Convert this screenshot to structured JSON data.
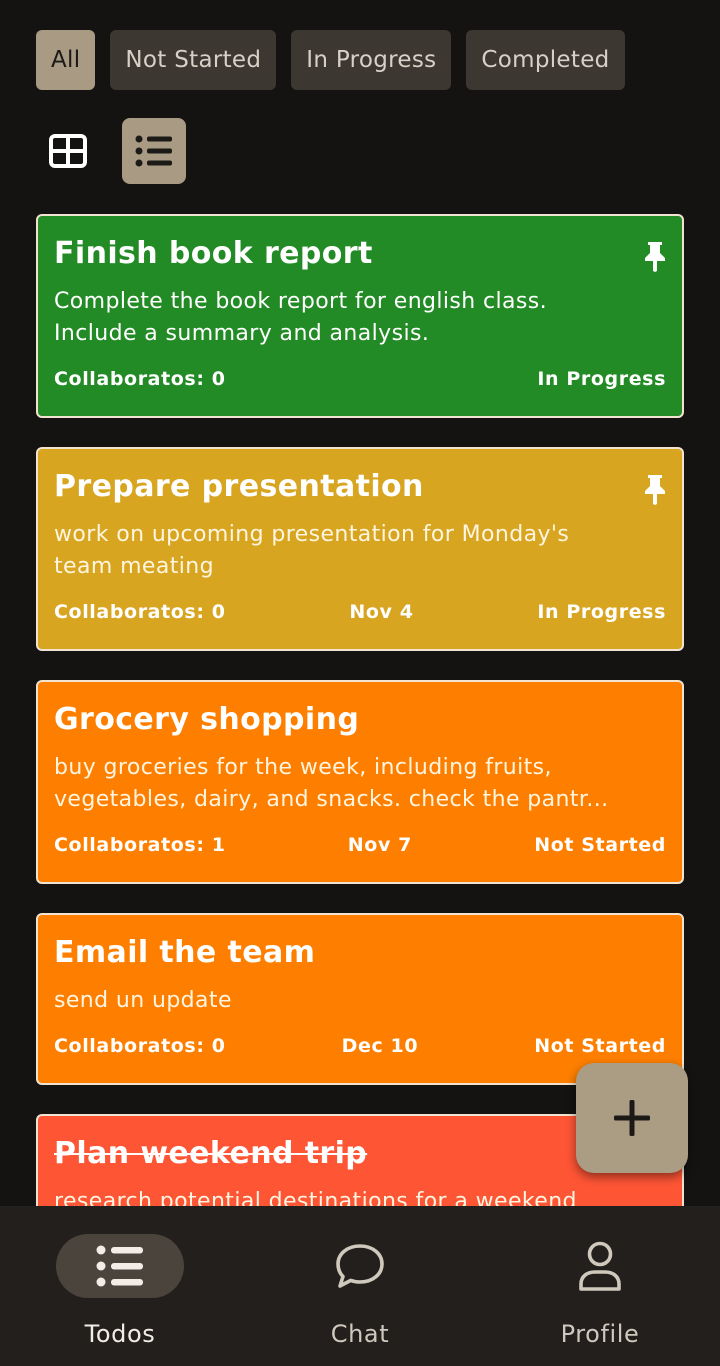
{
  "filters": [
    {
      "label": "All",
      "active": true
    },
    {
      "label": "Not Started",
      "active": false
    },
    {
      "label": "In Progress",
      "active": false
    },
    {
      "label": "Completed",
      "active": false
    }
  ],
  "view": {
    "grid_icon": "grid-icon",
    "list_icon": "list-icon",
    "active": "list"
  },
  "todos": [
    {
      "title": "Finish book report",
      "desc_lines": [
        "Complete the book report for english class.",
        "Include a summary and analysis."
      ],
      "collaborators": "Collaboratos: 0",
      "date": "",
      "status": "In Progress",
      "pinned": true,
      "color": "#238b26"
    },
    {
      "title": "Prepare presentation",
      "desc_lines": [
        "work on upcoming presentation for Monday's",
        "team meating"
      ],
      "collaborators": "Collaboratos: 0",
      "date": "Nov 4",
      "status": "In Progress",
      "pinned": true,
      "color": "#d8a520"
    },
    {
      "title": "Grocery shopping",
      "desc_lines": [
        "buy groceries for the week, including fruits,",
        "vegetables, dairy, and snacks. check the pantr..."
      ],
      "collaborators": "Collaboratos: 1",
      "date": "Nov 7",
      "status": "Not Started",
      "pinned": false,
      "color": "#fe7f00"
    },
    {
      "title": "Email the team",
      "desc_lines": [
        "send un update"
      ],
      "collaborators": "Collaboratos: 0",
      "date": "Dec 10",
      "status": "Not Started",
      "pinned": false,
      "color": "#fe7f00"
    },
    {
      "title": "Plan weekend trip",
      "desc_lines": [
        "research potential destinations for a weekend"
      ],
      "collaborators": "",
      "date": "",
      "status": "",
      "pinned": false,
      "completed": true,
      "color": "#fe5535"
    }
  ],
  "fab": {
    "icon": "plus-icon"
  },
  "nav": [
    {
      "label": "Todos",
      "icon": "list-icon",
      "active": true
    },
    {
      "label": "Chat",
      "icon": "chat-bubble-icon",
      "active": false
    },
    {
      "label": "Profile",
      "icon": "person-icon",
      "active": false
    }
  ]
}
